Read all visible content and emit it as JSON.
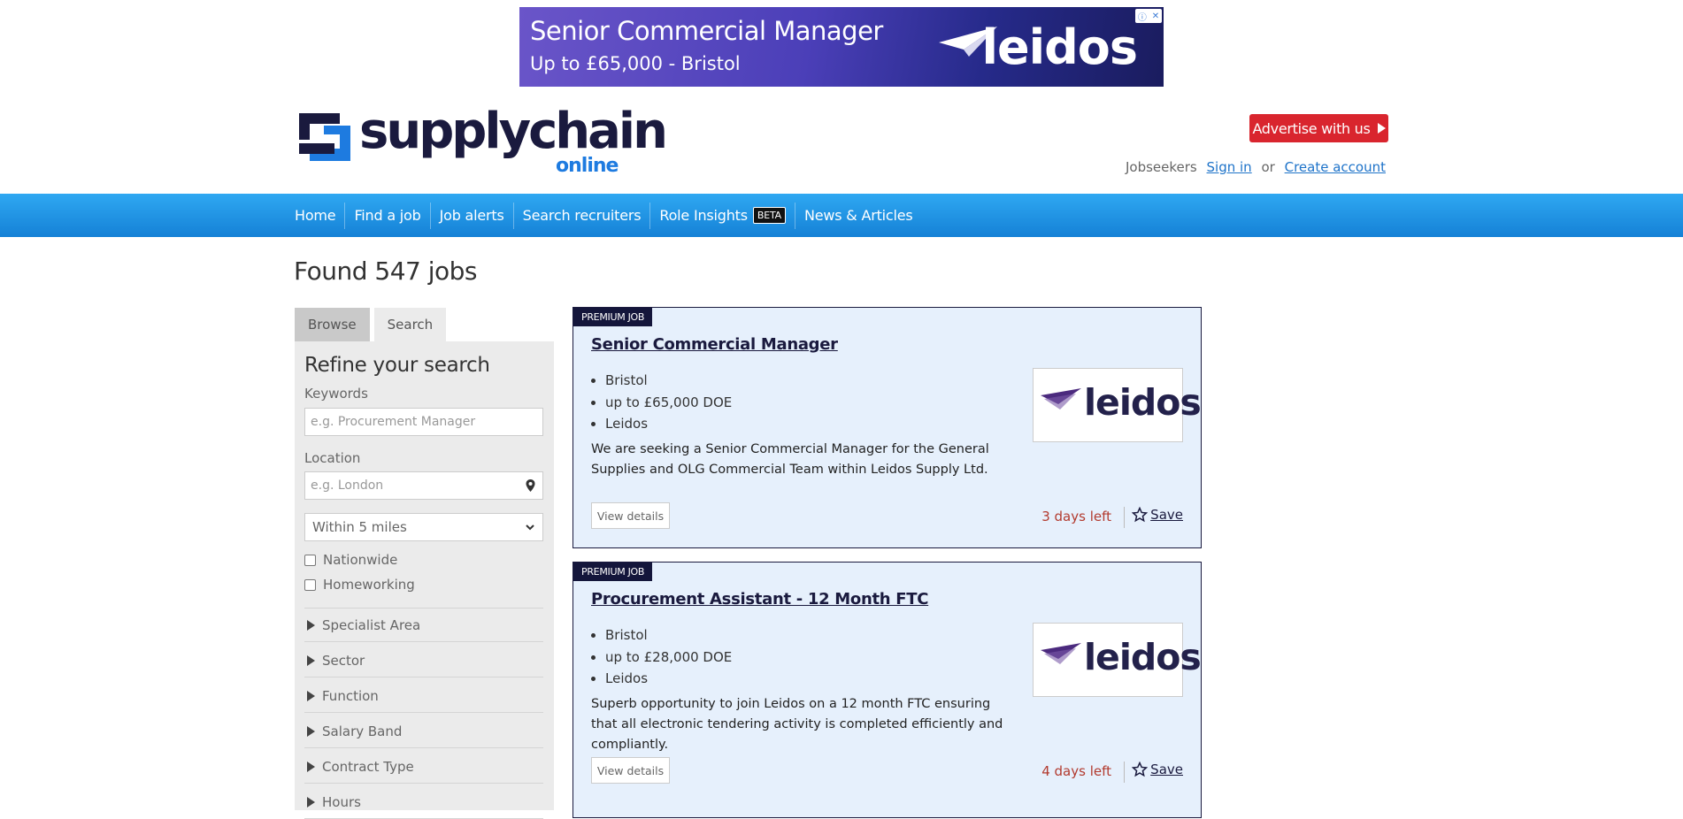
{
  "ad": {
    "line1": "Senior Commercial Manager",
    "line2": "Up to £65,000 - Bristol",
    "brand": "leidos"
  },
  "header": {
    "logo_main": "supplychain",
    "logo_sub": "online",
    "advertise_label": "Advertise with us",
    "jobseekers_label": "Jobseekers",
    "sign_in": "Sign in",
    "or": "or",
    "create_account": "Create account"
  },
  "nav": {
    "items": [
      "Home",
      "Find a job",
      "Job alerts",
      "Search recruiters",
      "Role Insights",
      "News & Articles"
    ],
    "beta": "BETA"
  },
  "results": {
    "found_text": "Found 547 jobs"
  },
  "sidebar": {
    "tabs": [
      "Browse",
      "Search"
    ],
    "heading": "Refine your search",
    "keywords_label": "Keywords",
    "keywords_placeholder": "e.g. Procurement Manager",
    "location_label": "Location",
    "location_placeholder": "e.g. London",
    "radius_selected": "Within 5 miles",
    "nationwide": "Nationwide",
    "homeworking": "Homeworking",
    "facets": [
      "Specialist Area",
      "Sector",
      "Function",
      "Salary Band",
      "Contract Type",
      "Hours"
    ]
  },
  "jobs": [
    {
      "badge": "PREMIUM JOB",
      "title": "Senior Commercial Manager",
      "location": "Bristol",
      "salary": "up to £65,000 DOE",
      "company": "Leidos",
      "description": "We are seeking a Senior Commercial Manager for the General Supplies and OLG Commercial Team within Leidos Supply Ltd.",
      "view_label": "View details",
      "days_left": "3 days left",
      "save_label": "Save",
      "logo_text": "leidos"
    },
    {
      "badge": "PREMIUM JOB",
      "title": "Procurement Assistant - 12 Month FTC",
      "location": "Bristol",
      "salary": "up to £28,000 DOE",
      "company": "Leidos",
      "description": "Superb opportunity to join Leidos on a 12 month FTC ensuring that all electronic tendering activity is completed efficiently and compliantly.",
      "view_label": "View details",
      "days_left": "4 days left",
      "save_label": "Save",
      "logo_text": "leidos"
    }
  ],
  "colors": {
    "nav": "#1e90e6",
    "brand_dark": "#1a1a3e",
    "accent_blue": "#1e7be0",
    "advertise_red": "#d9252e",
    "card_bg": "#e6f0fc",
    "days_left_red": "#b23a2e"
  }
}
